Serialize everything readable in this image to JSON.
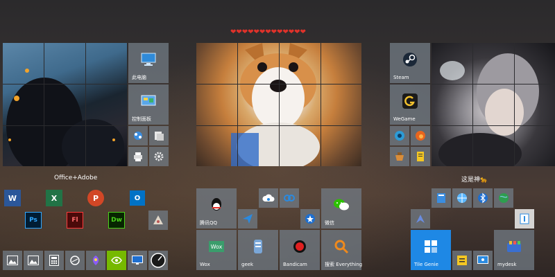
{
  "header": {
    "hearts": "❤❤❤❤❤❤❤❤❤❤❤❤❤"
  },
  "groups": {
    "office_adobe": {
      "title": "Office+Adobe"
    },
    "god": {
      "title": "这是神🐆"
    }
  },
  "tiles": {
    "this_pc": "此电脑",
    "control_panel": "控制面板",
    "steam": "Steam",
    "wegame": "WeGame",
    "tencent_qq": "腾讯QQ",
    "wechat": "微信",
    "wox": "Wox",
    "geek": "geek",
    "bandicam": "Bandicam",
    "search_everything": "搜索 Everything",
    "tile_genie": "Tile Genie",
    "mydesk": "mydesk"
  },
  "office_icons": {
    "word": "W",
    "excel": "X",
    "powerpoint": "P",
    "outlook": "O",
    "photoshop": "Ps",
    "flash": "Fl",
    "dreamweaver": "Dw",
    "wox_text": "Wox"
  },
  "colors": {
    "tile": "#707882",
    "tile_genie": "#1e88e5",
    "accent_heart": "#e0322a"
  }
}
